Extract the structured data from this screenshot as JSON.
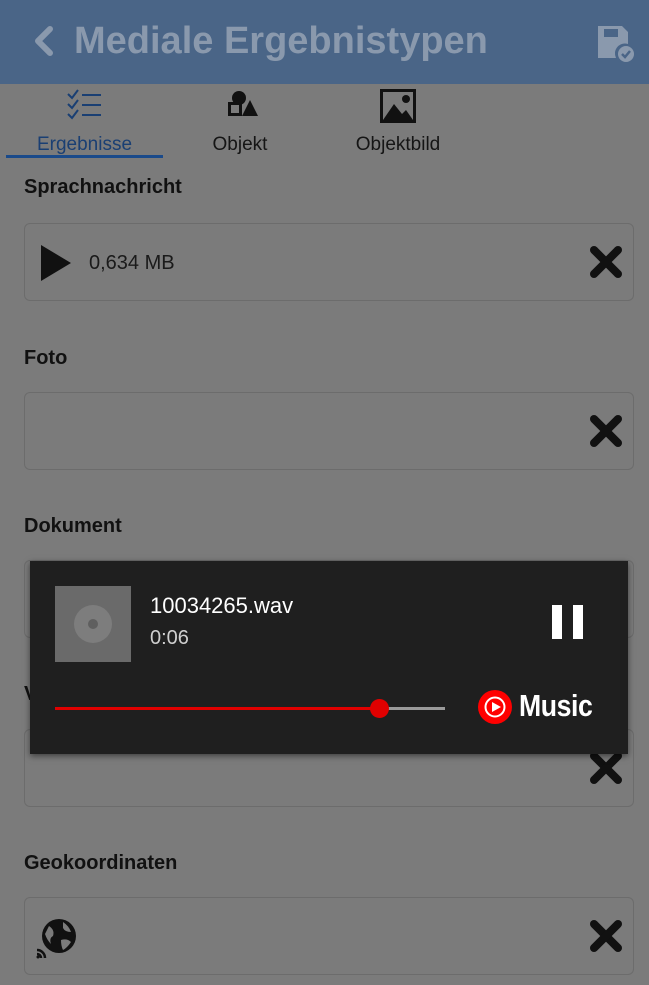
{
  "appbar": {
    "title": "Mediale Ergebnistypen",
    "back_icon": "chevron-left-icon",
    "save_icon": "save-check-icon",
    "background": "#4a6587"
  },
  "tabs": [
    {
      "label": "Ergebnisse",
      "icon": "checklist-icon",
      "active": true
    },
    {
      "label": "Objekt",
      "icon": "objects-icon",
      "active": false
    },
    {
      "label": "Objektbild",
      "icon": "image-icon",
      "active": false
    }
  ],
  "sections": {
    "voice": {
      "label": "Sprachnachricht",
      "value": "0,634 MB"
    },
    "photo": {
      "label": "Foto",
      "value": ""
    },
    "document": {
      "label": "Dokument",
      "value": ""
    },
    "video": {
      "label": "V",
      "value": ""
    },
    "geo": {
      "label": "Geokoordinaten",
      "value": ""
    }
  },
  "player": {
    "filename": "10034265.wav",
    "time": "0:06",
    "progress": 0.83,
    "brand": "Music",
    "accent": "#e00000"
  }
}
